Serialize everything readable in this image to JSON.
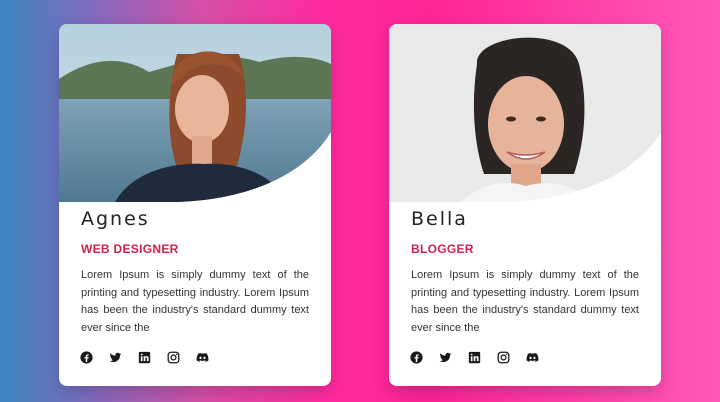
{
  "cards": [
    {
      "name": "Agnes",
      "role": "WEB DESIGNER",
      "description": "Lorem Ipsum is simply dummy text of the printing and typesetting industry. Lorem Ipsum has been the industry's standard dummy text ever since the",
      "socials": [
        "facebook-icon",
        "twitter-icon",
        "linkedin-icon",
        "instagram-icon",
        "discord-icon"
      ]
    },
    {
      "name": "Bella",
      "role": "BLOGGER",
      "description": "Lorem Ipsum is simply dummy text of the printing and typesetting industry. Lorem Ipsum has been the industry's standard dummy text ever since the",
      "socials": [
        "facebook-icon",
        "twitter-icon",
        "linkedin-icon",
        "instagram-icon",
        "discord-icon"
      ]
    }
  ],
  "colors": {
    "accent": "#d0214f",
    "card": "#ffffff",
    "text": "#333333"
  }
}
